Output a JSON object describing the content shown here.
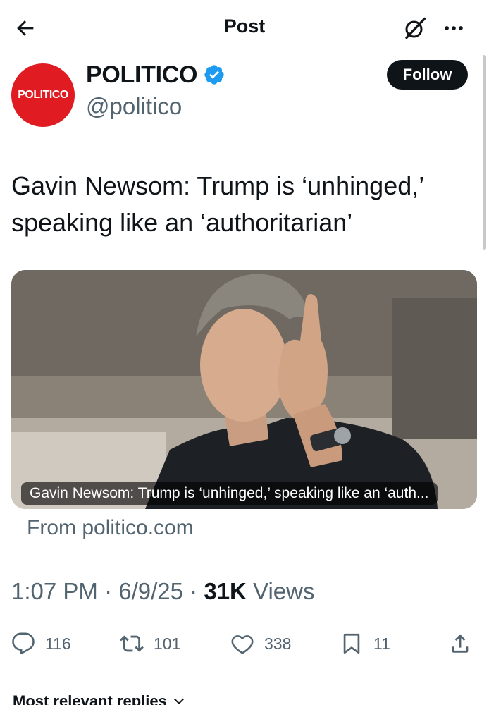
{
  "header": {
    "back_icon": "arrow-left-icon",
    "title": "Post",
    "grok_icon": "grok-slash-circle-icon",
    "more_icon": "more-dots-icon"
  },
  "author": {
    "avatar_text": "POLITICO",
    "avatar_color": "#e01b22",
    "display_name": "POLITICO",
    "verified_icon": "verified-badge-icon",
    "verified_color": "#1d9bf0",
    "handle": "@politico",
    "follow_label": "Follow"
  },
  "post": {
    "text": "Gavin Newsom: Trump is ‘unhinged,’ speaking like an ‘authoritarian’",
    "card": {
      "caption": "Gavin Newsom: Trump is ‘unhinged,’ speaking like an ‘auth...",
      "source": "From politico.com"
    },
    "time": "1:07 PM",
    "date": "6/9/25",
    "views_count": "31K",
    "views_label": "Views"
  },
  "actions": {
    "replies": {
      "icon": "reply-bubble-icon",
      "count": "116"
    },
    "reposts": {
      "icon": "repost-arrows-icon",
      "count": "101"
    },
    "likes": {
      "icon": "heart-icon",
      "count": "338"
    },
    "bookmarks": {
      "icon": "bookmark-icon",
      "count": "11"
    },
    "share": {
      "icon": "share-upload-icon"
    }
  },
  "replies_sort": {
    "label": "Most relevant replies",
    "icon": "chevron-down-icon"
  }
}
